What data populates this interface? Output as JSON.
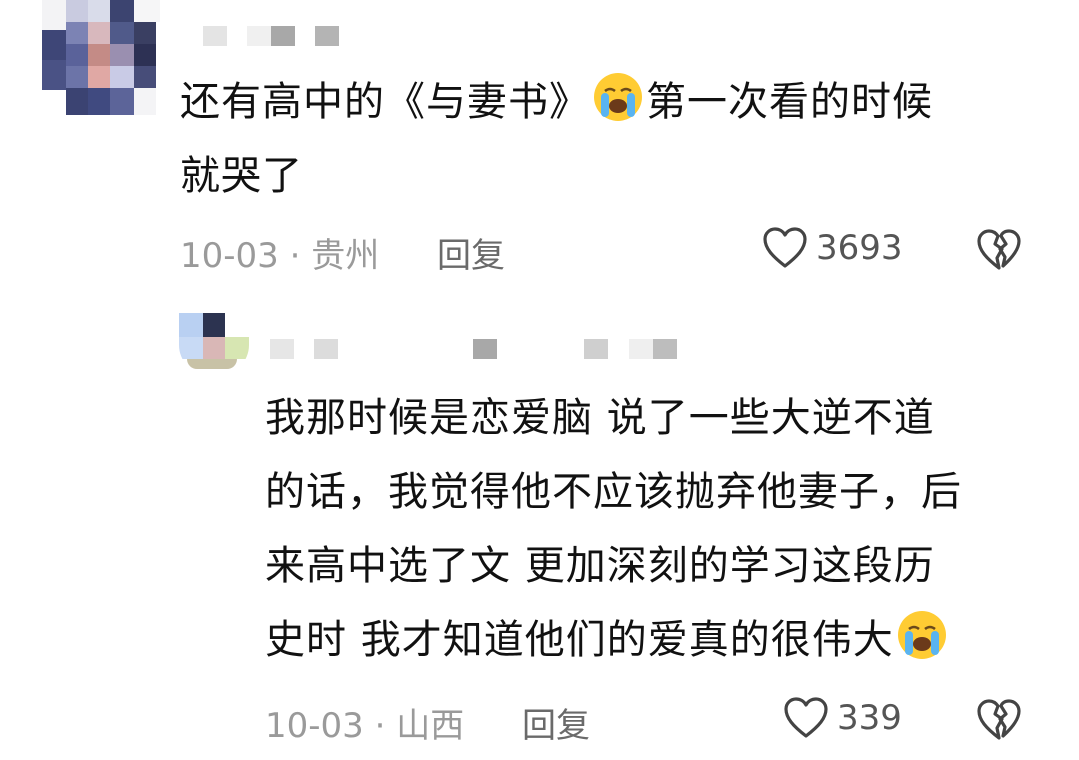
{
  "comments": [
    {
      "text_line1": "还有高中的《与妻书》",
      "text_line1b": "第一次看的时候",
      "text_line2": "就哭了",
      "emoji": "loudly-crying-face",
      "date": "10-03",
      "separator": "·",
      "location": "贵州",
      "reply_label": "回复",
      "likes": "3693"
    },
    {
      "lines": [
        "我那时候是恋爱脑 说了一些大逆不道",
        "的话，我觉得他不应该抛弃他妻子，后",
        "来高中选了文 更加深刻的学习这段历"
      ],
      "last_line": "史时 我才知道他们的爱真的很伟大",
      "emoji": "loudly-crying-face",
      "date": "10-03",
      "separator": "·",
      "location": "山西",
      "reply_label": "回复",
      "likes": "339"
    }
  ],
  "colors": {
    "text": "#111111",
    "meta": "#9a9a9a",
    "reply": "#6a6a6a",
    "icon": "#444444"
  },
  "icons": [
    "heart-outline-icon",
    "broken-heart-icon",
    "loudly-crying-face-emoji"
  ]
}
